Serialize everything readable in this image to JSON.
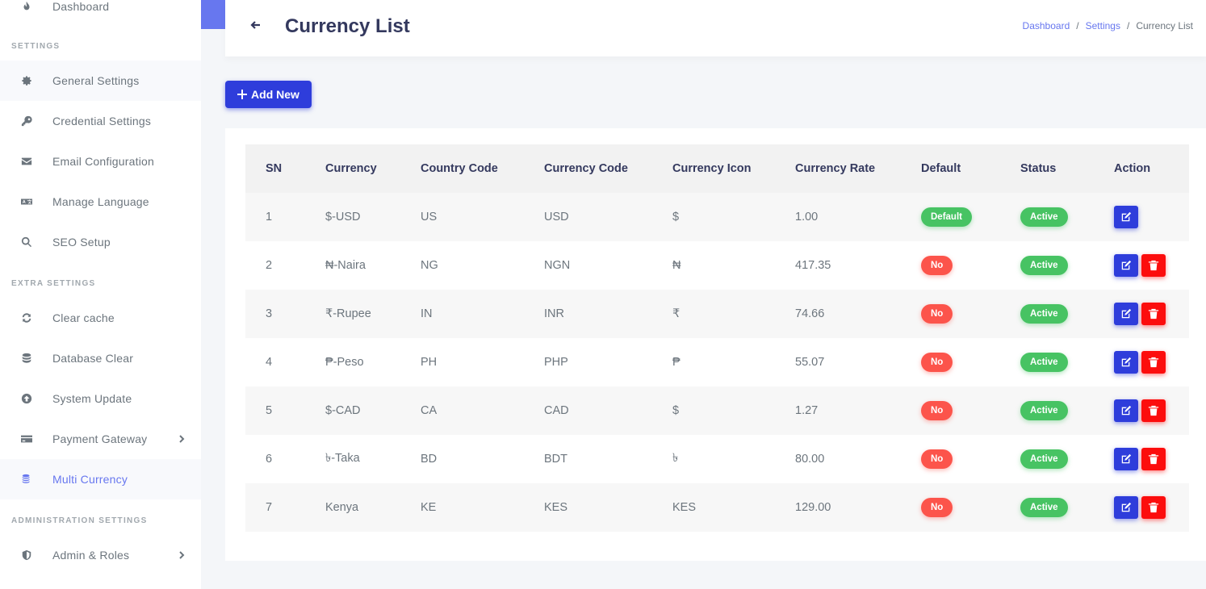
{
  "sidebar": {
    "dashboard_label": "Dashboard",
    "settings_header": "SETTINGS",
    "general_settings": "General Settings",
    "credential_settings": "Credential Settings",
    "email_configuration": "Email Configuration",
    "manage_language": "Manage Language",
    "seo_setup": "SEO Setup",
    "extra_header": "EXTRA SETTINGS",
    "clear_cache": "Clear cache",
    "database_clear": "Database Clear",
    "system_update": "System Update",
    "payment_gateway": "Payment Gateway",
    "multi_currency": "Multi Currency",
    "admin_header": "ADMINISTRATION SETTINGS",
    "admin_roles": "Admin & Roles"
  },
  "header": {
    "title": "Currency List",
    "breadcrumb": {
      "home": "Dashboard",
      "sep1": "/",
      "settings": "Settings",
      "sep2": "/",
      "current": "Currency List"
    }
  },
  "add_new_label": "Add New",
  "table": {
    "columns": {
      "sn": "SN",
      "currency": "Currency",
      "country_code": "Country Code",
      "currency_code": "Currency Code",
      "currency_icon": "Currency Icon",
      "currency_rate": "Currency Rate",
      "default": "Default",
      "status": "Status",
      "action": "Action"
    },
    "rows": [
      {
        "sn": "1",
        "currency": "$-USD",
        "country_code": "US",
        "currency_code": "USD",
        "currency_icon": "$",
        "rate": "1.00",
        "default": "Default",
        "status": "Active"
      },
      {
        "sn": "2",
        "currency": "₦-Naira",
        "country_code": "NG",
        "currency_code": "NGN",
        "currency_icon": "₦",
        "rate": "417.35",
        "default": "No",
        "status": "Active"
      },
      {
        "sn": "3",
        "currency": "₹-Rupee",
        "country_code": "IN",
        "currency_code": "INR",
        "currency_icon": "₹",
        "rate": "74.66",
        "default": "No",
        "status": "Active"
      },
      {
        "sn": "4",
        "currency": "₱-Peso",
        "country_code": "PH",
        "currency_code": "PHP",
        "currency_icon": "₱",
        "rate": "55.07",
        "default": "No",
        "status": "Active"
      },
      {
        "sn": "5",
        "currency": "$-CAD",
        "country_code": "CA",
        "currency_code": "CAD",
        "currency_icon": "$",
        "rate": "1.27",
        "default": "No",
        "status": "Active"
      },
      {
        "sn": "6",
        "currency": "৳-Taka",
        "country_code": "BD",
        "currency_code": "BDT",
        "currency_icon": "৳",
        "rate": "80.00",
        "default": "No",
        "status": "Active"
      },
      {
        "sn": "7",
        "currency": "Kenya",
        "country_code": "KE",
        "currency_code": "KES",
        "currency_icon": "KES",
        "rate": "129.00",
        "default": "No",
        "status": "Active"
      }
    ]
  },
  "colors": {
    "accent": "#6777ef",
    "primary_button": "#2e3ddb",
    "success": "#47c363",
    "danger": "#fc544b",
    "delete_button": "#fc0d0d"
  },
  "icons": {
    "dashboard": "fire-icon",
    "general": "gear-icon",
    "credential": "key-icon",
    "email": "envelope-icon",
    "language": "language-icon",
    "seo": "search-icon",
    "cache": "refresh-icon",
    "database": "database-icon",
    "update": "arrow-circle-up-icon",
    "payment": "credit-card-icon",
    "currency": "coins-icon",
    "admin": "shield-icon",
    "edit": "edit-icon",
    "delete": "trash-icon",
    "back": "arrow-left-icon",
    "plus": "plus-icon"
  }
}
